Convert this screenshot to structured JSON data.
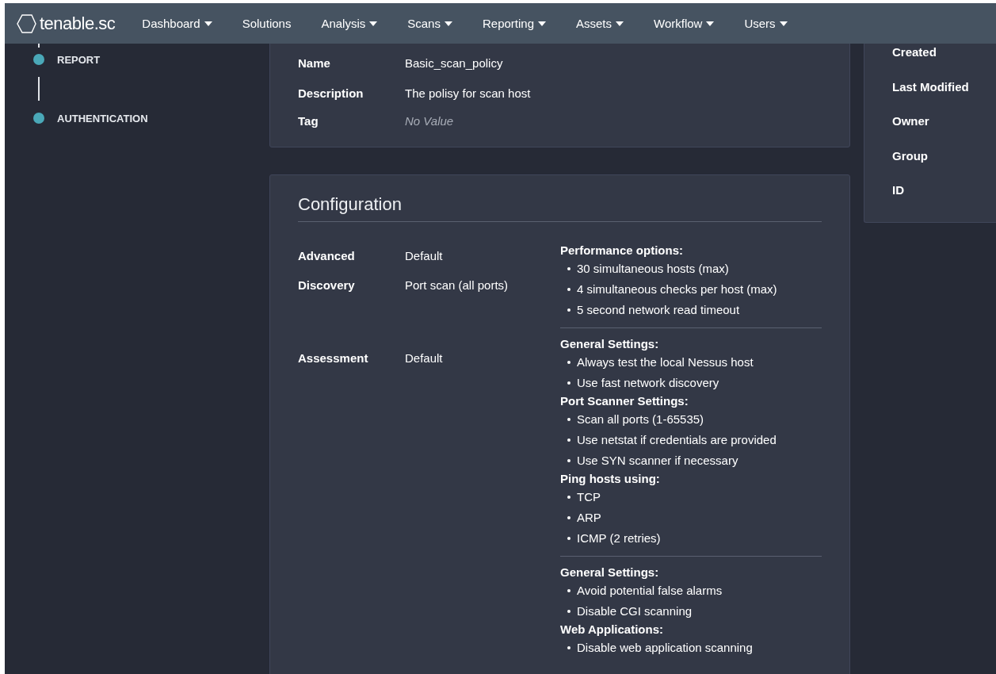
{
  "nav": {
    "logo": "tenable.sc",
    "items": [
      {
        "label": "Dashboard",
        "has_menu": true
      },
      {
        "label": "Solutions",
        "has_menu": false
      },
      {
        "label": "Analysis",
        "has_menu": true
      },
      {
        "label": "Scans",
        "has_menu": true
      },
      {
        "label": "Reporting",
        "has_menu": true
      },
      {
        "label": "Assets",
        "has_menu": true
      },
      {
        "label": "Workflow",
        "has_menu": true
      },
      {
        "label": "Users",
        "has_menu": true
      }
    ]
  },
  "steps": [
    {
      "label": "REPORT"
    },
    {
      "label": "AUTHENTICATION"
    }
  ],
  "general": {
    "rows": [
      {
        "label": "Name",
        "value": "Basic_scan_policy",
        "empty": false
      },
      {
        "label": "Description",
        "value": "The polisy for scan host",
        "empty": false
      },
      {
        "label": "Tag",
        "value": "No Value",
        "empty": true
      }
    ]
  },
  "configuration": {
    "title": "Configuration",
    "rows": [
      {
        "label": "Advanced",
        "value": "Default"
      },
      {
        "label": "Discovery",
        "value": "Port scan (all ports)"
      },
      {
        "label": "Assessment",
        "value": "Default"
      }
    ],
    "groups": [
      [
        {
          "heading": "Performance options:",
          "items": [
            "30 simultaneous hosts (max)",
            "4 simultaneous checks per host (max)",
            "5 second network read timeout"
          ]
        }
      ],
      [
        {
          "heading": "General Settings:",
          "items": [
            "Always test the local Nessus host",
            "Use fast network discovery"
          ]
        },
        {
          "heading": "Port Scanner Settings:",
          "items": [
            "Scan all ports (1-65535)",
            "Use netstat if credentials are provided",
            "Use SYN scanner if necessary"
          ]
        },
        {
          "heading": "Ping hosts using:",
          "items": [
            "TCP",
            "ARP",
            "ICMP (2 retries)"
          ]
        }
      ],
      [
        {
          "heading": "General Settings:",
          "items": [
            "Avoid potential false alarms",
            "Disable CGI scanning"
          ]
        },
        {
          "heading": "Web Applications:",
          "items": [
            "Disable web application scanning"
          ]
        }
      ]
    ]
  },
  "details": {
    "labels": [
      "Created",
      "Last Modified",
      "Owner",
      "Group",
      "ID"
    ]
  }
}
